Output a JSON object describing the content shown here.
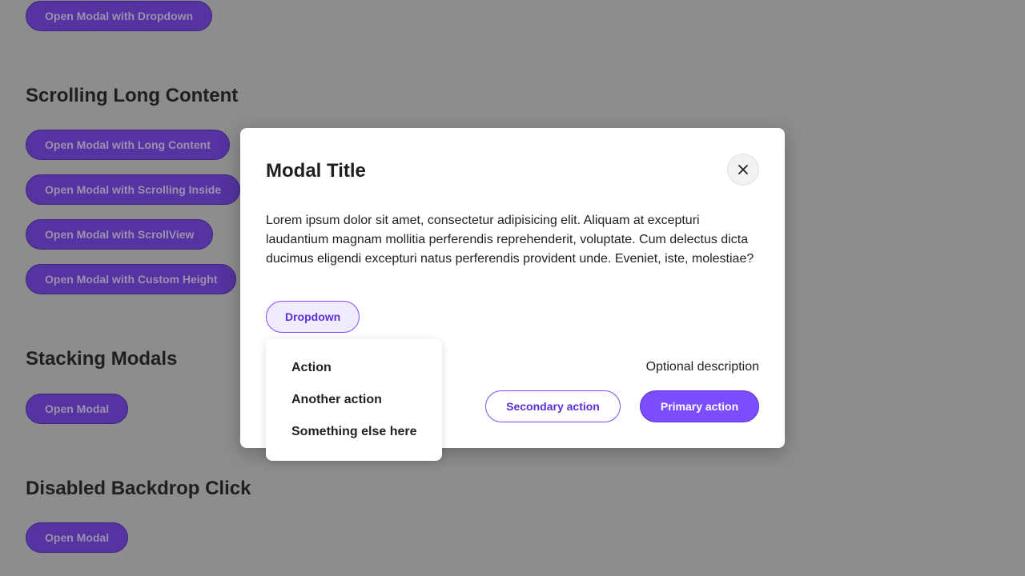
{
  "background": {
    "top_button": "Open Modal with Dropdown",
    "sections": [
      {
        "heading": "Scrolling Long Content",
        "buttons": [
          "Open Modal with Long Content",
          "Open Modal with Scrolling Inside",
          "Open Modal with ScrollView",
          "Open Modal with Custom Height"
        ]
      },
      {
        "heading": "Stacking Modals",
        "buttons": [
          "Open Modal"
        ]
      },
      {
        "heading": "Disabled Backdrop Click",
        "buttons": [
          "Open Modal"
        ]
      }
    ]
  },
  "modal": {
    "title": "Modal Title",
    "close_icon": "close-icon",
    "body": "Lorem ipsum dolor sit amet, consectetur adipisicing elit. Aliquam at excepturi laudantium magnam mollitia perferendis reprehenderit, voluptate. Cum delectus dicta ducimus eligendi excepturi natus perferendis provident unde. Eveniet, iste, molestiae?",
    "dropdown_label": "Dropdown",
    "dropdown_items": [
      "Action",
      "Another action",
      "Something else here"
    ],
    "optional_description": "Optional description",
    "secondary_action": "Secondary action",
    "primary_action": "Primary action"
  },
  "colors": {
    "accent": "#7c4dff",
    "backdrop": "#8d8d8d"
  }
}
